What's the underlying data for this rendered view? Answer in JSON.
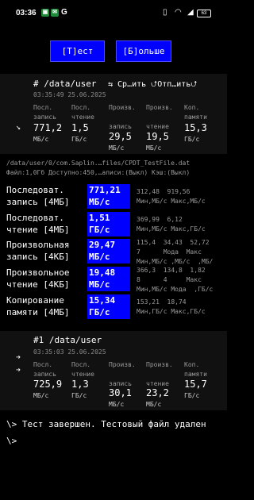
{
  "status_bar": {
    "time": "03:36",
    "notif_letter": "G",
    "battery": "63"
  },
  "buttons": {
    "test": "[T]ест",
    "more": "[Б]ольше"
  },
  "run1": {
    "title": "#  /data/user",
    "actions": "⇆ Ср…ить  ⮍Отп…ить⮍",
    "timestamp": "03:35:49 25.06.2025",
    "cols": [
      {
        "label": "Посл.\nзапись",
        "value": "771,2",
        "unit": "МБ/с"
      },
      {
        "label": "Посл.\nчтение",
        "value": "1,5",
        "unit": "ГБ/с"
      },
      {
        "label": "Произв.\n\nзапись",
        "value": "29,5",
        "unit": "МБ/с"
      },
      {
        "label": "Произв.\n\nчтение",
        "value": "19,5",
        "unit": "МБ/с"
      },
      {
        "label": "Коп.\nпамяти",
        "value": "15,3",
        "unit": "ГБ/с"
      }
    ]
  },
  "file_info": {
    "path": "/data/user/0/com.Saplin.…files/CPDT_TestFile.dat",
    "details": "Файл:1,0Гб Доступно:450,…аписи:(Выкл) Кэш:(Выкл)"
  },
  "results": [
    {
      "label": "Последоват.\nзапись [4МБ]",
      "value": "771,21\nМБ/с",
      "stats": "312,48  919,56\nМин,МБ/с Макс,МБ/с"
    },
    {
      "label": "Последоват.\nчтение [4МБ]",
      "value": "1,51\nГБ/с",
      "stats": "369,99  6,12\nМин,МБ/с Макс,ГБ/с"
    },
    {
      "label": "Произвольная\nзапись [4КБ]",
      "value": "29,47\nМБ/с",
      "stats": "115,4  34,43  52,72\n7      Мода  Макс\nМин,МБ/с ,МБ/с  ,МБ/"
    },
    {
      "label": "Произвольное\nчтение [4КБ]",
      "value": "19,48\nМБ/с",
      "stats": "366,3  134,8  1,82\n8      4     Макс\nМин,МБ/с Мода  ,ГБ/с"
    },
    {
      "label": "Копирование\nпамяти [4МБ]",
      "value": "15,34\nГБ/с",
      "stats": "153,21  18,74\nМин,ГБ/с Макс,ГБ/с"
    }
  ],
  "run2": {
    "title": "#1 /data/user",
    "timestamp": "03:35:03 25.06.2025",
    "cols": [
      {
        "label": "Посл.\nзапись",
        "value": "725,9",
        "unit": "МБ/с"
      },
      {
        "label": "Посл.\nчтение",
        "value": "1,3",
        "unit": "ГБ/с"
      },
      {
        "label": "Произв.\n\nзапись",
        "value": "30,1",
        "unit": "МБ/с"
      },
      {
        "label": "Произв.\n\nчтение",
        "value": "23,2",
        "unit": "МБ/с"
      },
      {
        "label": "Коп.\nпамяти",
        "value": "15,7",
        "unit": "ГБ/с"
      }
    ]
  },
  "terminal": {
    "line1": "\\> Тест завершен. Тестовый файл удален",
    "line2": "\\>"
  }
}
